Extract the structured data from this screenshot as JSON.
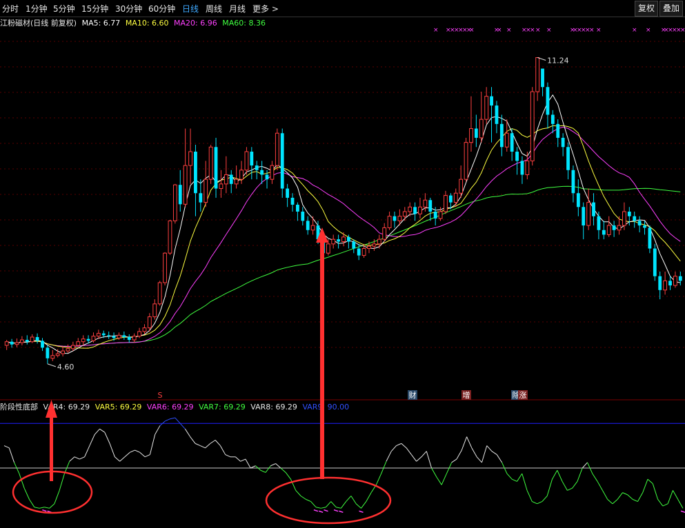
{
  "toolbar": {
    "tabs": [
      "分时",
      "1分钟",
      "5分钟",
      "15分钟",
      "30分钟",
      "60分钟",
      "日线",
      "周线",
      "月线",
      "更多 >"
    ],
    "active": "日线",
    "btn_fuquan": "复权",
    "btn_diejia": "叠加"
  },
  "stock": {
    "title": "江粉磁材(日线 前复权)",
    "ma5": "MA5: 6.77",
    "ma10": "MA10: 6.60",
    "ma20": "MA20: 6.96",
    "ma60": "MA60: 8.36"
  },
  "indicator": {
    "title": "阶段性底部",
    "var4": "VAR4: 69.29",
    "var5": "VAR5: 69.29",
    "var6": "VAR6: 69.29",
    "var7": "VAR7: 69.29",
    "var8": "VAR8: 69.29",
    "var9": "VAR9: 90.00"
  },
  "colors": {
    "up": "#ff4040",
    "down": "#00e5ff",
    "ma5": "#ffffff",
    "ma10": "#ffff40",
    "ma20": "#ff40ff",
    "ma60": "#40ff40",
    "var9": "#2020ff",
    "arrow": "#ff3030"
  },
  "chart_data": {
    "type": "candlestick",
    "ylim": [
      4.0,
      11.8
    ],
    "annotations": {
      "high": "11.24",
      "low": "4.60"
    },
    "event_markers": [
      "S",
      "财",
      "增",
      "除",
      "涨"
    ],
    "candles": [
      [
        5.0,
        5.08,
        4.9,
        5.12
      ],
      [
        5.08,
        5.02,
        4.95,
        5.14
      ],
      [
        5.02,
        5.06,
        4.96,
        5.15
      ],
      [
        5.06,
        5.12,
        5.0,
        5.2
      ],
      [
        5.12,
        5.08,
        5.02,
        5.22
      ],
      [
        5.08,
        5.18,
        5.05,
        5.24
      ],
      [
        5.18,
        5.1,
        5.04,
        5.26
      ],
      [
        5.1,
        4.95,
        4.88,
        5.16
      ],
      [
        4.95,
        4.72,
        4.6,
        5.0
      ],
      [
        4.72,
        4.78,
        4.66,
        4.9
      ],
      [
        4.78,
        4.82,
        4.74,
        4.92
      ],
      [
        4.82,
        4.88,
        4.76,
        4.98
      ],
      [
        4.88,
        4.93,
        4.84,
        5.02
      ],
      [
        4.93,
        5.0,
        4.88,
        5.08
      ],
      [
        5.0,
        5.08,
        4.96,
        5.16
      ],
      [
        5.08,
        5.14,
        5.0,
        5.22
      ],
      [
        5.14,
        5.1,
        5.04,
        5.22
      ],
      [
        5.1,
        5.2,
        5.06,
        5.28
      ],
      [
        5.2,
        5.26,
        5.14,
        5.34
      ],
      [
        5.26,
        5.22,
        5.16,
        5.32
      ],
      [
        5.22,
        5.2,
        5.14,
        5.3
      ],
      [
        5.2,
        5.16,
        5.1,
        5.28
      ],
      [
        5.16,
        5.22,
        5.12,
        5.28
      ],
      [
        5.22,
        5.18,
        5.12,
        5.3
      ],
      [
        5.18,
        5.12,
        5.06,
        5.24
      ],
      [
        5.12,
        5.2,
        5.06,
        5.26
      ],
      [
        5.2,
        5.3,
        5.16,
        5.38
      ],
      [
        5.3,
        5.38,
        5.24,
        5.46
      ],
      [
        5.38,
        5.62,
        5.3,
        5.7
      ],
      [
        5.62,
        5.9,
        5.56,
        6.0
      ],
      [
        5.9,
        6.36,
        5.86,
        6.4
      ],
      [
        6.36,
        7.0,
        6.3,
        7.02
      ],
      [
        7.0,
        7.7,
        6.96,
        7.72
      ],
      [
        7.7,
        8.48,
        7.64,
        8.5
      ],
      [
        8.48,
        8.06,
        7.9,
        8.8
      ],
      [
        8.06,
        8.9,
        8.0,
        9.7
      ],
      [
        8.9,
        9.2,
        8.5,
        9.7
      ],
      [
        9.2,
        8.3,
        7.8,
        9.35
      ],
      [
        8.3,
        8.1,
        7.9,
        8.6
      ],
      [
        8.1,
        8.6,
        8.0,
        9.0
      ],
      [
        8.6,
        9.3,
        8.5,
        9.35
      ],
      [
        9.3,
        8.4,
        8.2,
        9.5
      ],
      [
        8.4,
        8.5,
        8.2,
        8.8
      ],
      [
        8.5,
        8.7,
        8.3,
        9.1
      ],
      [
        8.7,
        8.5,
        8.3,
        8.8
      ],
      [
        8.5,
        8.6,
        8.4,
        8.9
      ],
      [
        8.6,
        8.8,
        8.5,
        9.0
      ],
      [
        8.8,
        9.2,
        8.7,
        9.3
      ],
      [
        9.2,
        8.9,
        8.6,
        9.3
      ],
      [
        8.9,
        8.8,
        8.6,
        9.0
      ],
      [
        8.8,
        8.7,
        8.5,
        9.0
      ],
      [
        8.7,
        8.6,
        8.4,
        8.8
      ],
      [
        8.6,
        8.9,
        8.5,
        9.0
      ],
      [
        8.9,
        9.6,
        8.8,
        9.7
      ],
      [
        9.6,
        8.4,
        8.2,
        9.7
      ],
      [
        8.4,
        8.2,
        8.0,
        8.5
      ],
      [
        8.2,
        8.05,
        7.9,
        8.3
      ],
      [
        8.05,
        7.9,
        7.7,
        8.1
      ],
      [
        7.9,
        7.7,
        7.6,
        8.0
      ],
      [
        7.7,
        7.5,
        7.4,
        7.8
      ],
      [
        7.5,
        7.6,
        7.4,
        7.8
      ],
      [
        7.6,
        7.3,
        7.2,
        7.7
      ],
      [
        7.3,
        7.0,
        6.9,
        7.4
      ],
      [
        7.0,
        7.2,
        6.95,
        7.3
      ],
      [
        7.2,
        7.3,
        7.1,
        7.4
      ],
      [
        7.3,
        7.25,
        7.1,
        7.4
      ],
      [
        7.25,
        7.35,
        7.15,
        7.45
      ],
      [
        7.35,
        7.25,
        7.1,
        7.4
      ],
      [
        7.25,
        7.1,
        7.0,
        7.3
      ],
      [
        7.1,
        6.95,
        6.85,
        7.2
      ],
      [
        6.95,
        7.1,
        6.9,
        7.2
      ],
      [
        7.1,
        7.15,
        7.0,
        7.25
      ],
      [
        7.15,
        7.2,
        7.05,
        7.3
      ],
      [
        7.2,
        7.3,
        7.1,
        7.4
      ],
      [
        7.3,
        7.55,
        7.25,
        7.65
      ],
      [
        7.55,
        7.8,
        7.5,
        7.9
      ],
      [
        7.8,
        7.7,
        7.55,
        7.9
      ],
      [
        7.7,
        7.8,
        7.6,
        7.95
      ],
      [
        7.8,
        7.9,
        7.7,
        8.0
      ],
      [
        7.9,
        8.0,
        7.8,
        8.1
      ],
      [
        8.0,
        7.85,
        7.7,
        8.1
      ],
      [
        7.85,
        8.0,
        7.75,
        8.2
      ],
      [
        8.0,
        8.15,
        7.9,
        8.3
      ],
      [
        8.15,
        7.9,
        7.7,
        8.2
      ],
      [
        7.9,
        7.75,
        7.6,
        8.0
      ],
      [
        7.75,
        7.9,
        7.7,
        8.0
      ],
      [
        7.9,
        8.25,
        7.85,
        8.35
      ],
      [
        8.25,
        8.1,
        7.95,
        8.3
      ],
      [
        8.1,
        8.3,
        8.0,
        8.4
      ],
      [
        8.3,
        8.6,
        8.2,
        8.9
      ],
      [
        8.6,
        9.4,
        8.55,
        9.5
      ],
      [
        9.4,
        9.7,
        9.2,
        10.4
      ],
      [
        9.7,
        9.5,
        9.3,
        10.0
      ],
      [
        9.5,
        9.9,
        9.4,
        10.5
      ],
      [
        9.9,
        10.4,
        9.8,
        10.6
      ],
      [
        10.4,
        10.2,
        9.4,
        10.6
      ],
      [
        10.2,
        9.8,
        9.6,
        10.3
      ],
      [
        9.8,
        9.3,
        9.1,
        10.0
      ],
      [
        9.3,
        9.6,
        9.2,
        9.9
      ],
      [
        9.6,
        9.2,
        9.0,
        9.7
      ],
      [
        9.2,
        9.0,
        8.7,
        9.3
      ],
      [
        9.0,
        8.7,
        8.5,
        9.1
      ],
      [
        8.7,
        9.0,
        8.6,
        9.2
      ],
      [
        9.0,
        10.5,
        8.9,
        10.6
      ],
      [
        10.5,
        11.24,
        10.3,
        11.24
      ],
      [
        11.0,
        10.6,
        10.4,
        11.0
      ],
      [
        10.6,
        10.0,
        9.7,
        10.7
      ],
      [
        10.0,
        9.8,
        9.6,
        10.1
      ],
      [
        9.8,
        9.5,
        9.3,
        9.9
      ],
      [
        9.5,
        9.3,
        9.1,
        9.6
      ],
      [
        9.3,
        8.8,
        8.6,
        9.4
      ],
      [
        8.8,
        8.3,
        8.1,
        8.9
      ],
      [
        8.3,
        8.0,
        7.8,
        8.6
      ],
      [
        8.0,
        7.6,
        7.3,
        8.1
      ],
      [
        7.6,
        8.1,
        7.5,
        8.4
      ],
      [
        8.1,
        7.8,
        7.6,
        8.3
      ],
      [
        7.8,
        7.5,
        7.3,
        7.9
      ],
      [
        7.5,
        7.4,
        7.3,
        7.7
      ],
      [
        7.4,
        7.6,
        7.35,
        7.8
      ],
      [
        7.6,
        7.5,
        7.35,
        7.7
      ],
      [
        7.5,
        7.6,
        7.4,
        7.8
      ],
      [
        7.6,
        7.9,
        7.5,
        8.1
      ],
      [
        7.9,
        7.8,
        7.6,
        8.0
      ],
      [
        7.8,
        7.7,
        7.55,
        7.9
      ],
      [
        7.7,
        7.6,
        7.45,
        7.8
      ],
      [
        7.6,
        7.55,
        7.4,
        7.7
      ],
      [
        7.55,
        7.1,
        7.0,
        7.6
      ],
      [
        7.1,
        6.5,
        6.4,
        7.2
      ],
      [
        6.5,
        6.2,
        6.0,
        6.6
      ],
      [
        6.2,
        6.4,
        6.1,
        6.6
      ],
      [
        6.4,
        6.3,
        6.2,
        6.5
      ],
      [
        6.3,
        6.5,
        6.25,
        6.6
      ],
      [
        6.5,
        6.4,
        6.3,
        6.6
      ]
    ],
    "indicator_ylim": [
      0,
      100
    ],
    "var4_threshold": 50,
    "var9_level": 90,
    "var8": [
      70,
      68,
      55,
      45,
      32,
      22,
      15,
      14,
      15,
      14,
      18,
      30,
      45,
      56,
      60,
      58,
      60,
      70,
      80,
      85,
      82,
      72,
      60,
      56,
      60,
      64,
      66,
      64,
      60,
      62,
      80,
      88,
      92,
      94,
      95,
      90,
      85,
      78,
      72,
      70,
      68,
      72,
      75,
      70,
      62,
      60,
      60,
      56,
      58,
      50,
      52,
      48,
      46,
      52,
      54,
      50,
      46,
      40,
      30,
      25,
      22,
      20,
      15,
      14,
      15,
      20,
      15,
      14,
      20,
      25,
      18,
      14,
      20,
      28,
      35,
      45,
      56,
      65,
      70,
      72,
      68,
      62,
      56,
      60,
      65,
      50,
      42,
      35,
      45,
      55,
      58,
      66,
      78,
      68,
      60,
      55,
      70,
      65,
      62,
      55,
      45,
      40,
      38,
      45,
      30,
      20,
      18,
      20,
      25,
      40,
      48,
      38,
      30,
      32,
      38,
      50,
      55,
      45,
      38,
      30,
      22,
      18,
      22,
      28,
      26,
      22,
      20,
      28,
      40,
      36,
      22,
      16,
      18,
      30,
      22,
      14
    ]
  }
}
